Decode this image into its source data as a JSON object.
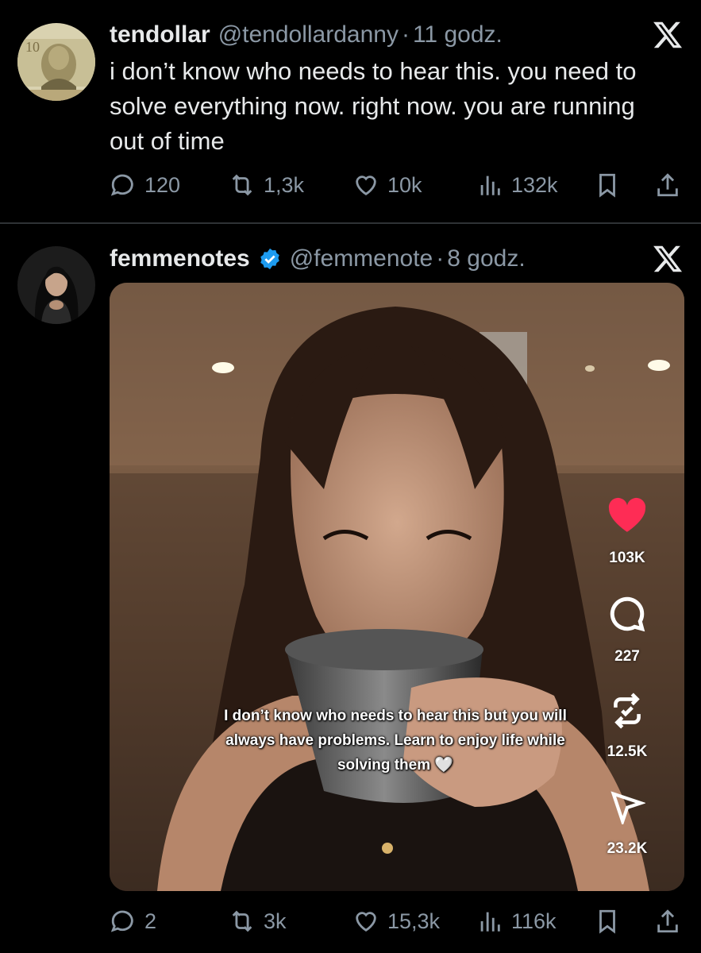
{
  "tweets": [
    {
      "display_name": "tendollar",
      "handle": "@tendollardanny",
      "separator": "·",
      "time": "11 godz.",
      "text": "i don’t know who needs to hear this. you need to solve everything now. right now. you are running out of time",
      "replies": "120",
      "reposts": "1,3k",
      "likes": "10k",
      "views": "132k"
    },
    {
      "display_name": "femmenotes",
      "handle": "@femmenote",
      "separator": "·",
      "time": "8 godz.",
      "verified": true,
      "media": {
        "caption": "I don’t know who needs to hear this but you will always have problems. Learn to enjoy life while solving them 🤍",
        "likes": "103K",
        "comments": "227",
        "reposts": "12.5K",
        "shares": "23.2K",
        "like_color": "#fe2c55"
      },
      "replies": "2",
      "reposts": "3k",
      "likes": "15,3k",
      "views": "116k"
    }
  ],
  "icons": {
    "logo": "x-logo-icon",
    "reply": "speech-bubble-icon",
    "repost": "repost-arrows-icon",
    "like": "heart-icon",
    "views": "bar-chart-icon",
    "bookmark": "bookmark-icon",
    "share": "share-upload-icon",
    "verified": "verified-badge-icon"
  },
  "colors": {
    "background": "#000000",
    "text": "#e7e9ea",
    "secondary": "#8b98a5",
    "verified": "#1d9bf0",
    "divider": "#2f3336"
  }
}
